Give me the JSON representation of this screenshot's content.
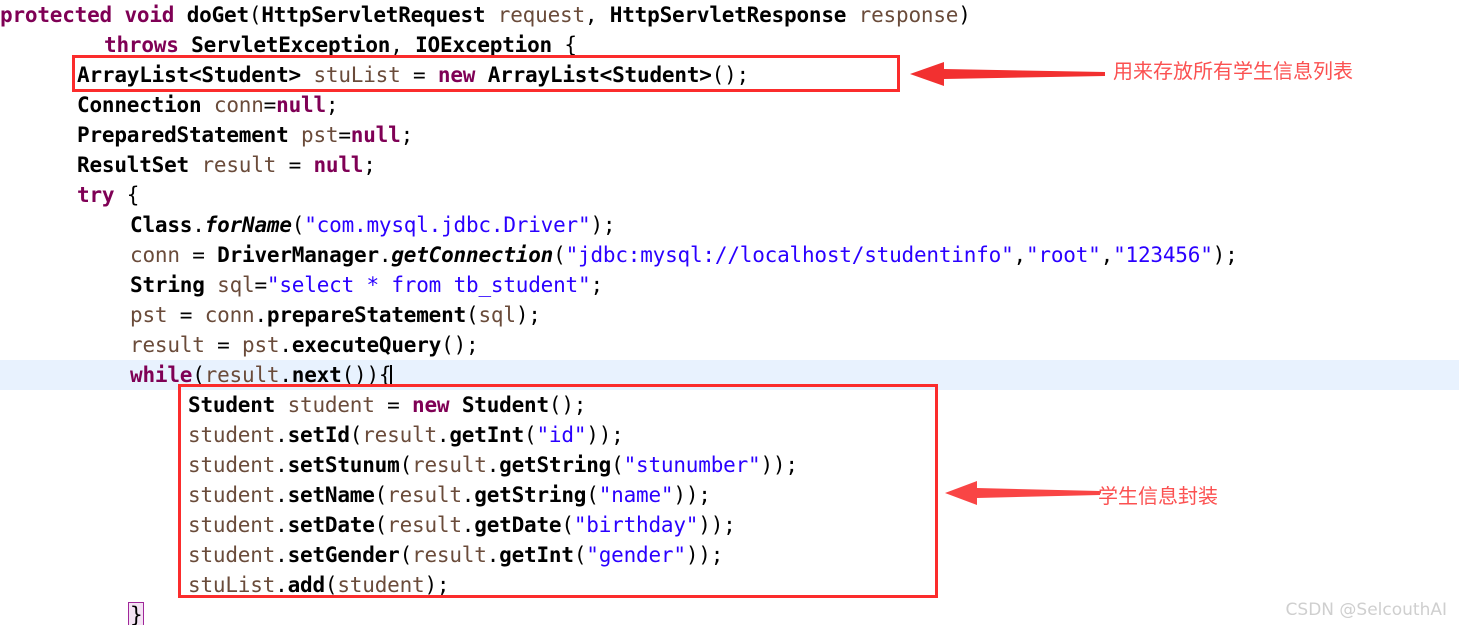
{
  "editor": {
    "language": "java",
    "current_line_index": 10,
    "caret_visible": true,
    "colors": {
      "background": "#ffffff",
      "keyword": "#7f0055",
      "string": "#2a00ff",
      "local_variable": "#6a4b3a",
      "plain_text": "#000000",
      "current_line_highlight": "#e8f2fe",
      "bracket_match_border": "#a0279a",
      "annotation_red": "#fb2c2c",
      "annotation_label_red": "#fb5151",
      "watermark": "#cfcfcf"
    },
    "lines": [
      {
        "indent": 0,
        "text": "protected void doGet(HttpServletRequest request, HttpServletResponse response)"
      },
      {
        "indent": 8,
        "text": "throws ServletException, IOException {"
      },
      {
        "indent": 4,
        "text": "ArrayList<Student> stuList = new ArrayList<Student>();"
      },
      {
        "indent": 4,
        "text": "Connection conn=null;"
      },
      {
        "indent": 4,
        "text": "PreparedStatement pst=null;"
      },
      {
        "indent": 4,
        "text": "ResultSet result = null;"
      },
      {
        "indent": 4,
        "text": "try {"
      },
      {
        "indent": 8,
        "text": "Class.forName(\"com.mysql.jdbc.Driver\");"
      },
      {
        "indent": 8,
        "text": "conn = DriverManager.getConnection(\"jdbc:mysql://localhost/studentinfo\",\"root\",\"123456\");"
      },
      {
        "indent": 8,
        "text": "String sql=\"select * from tb_student\";"
      },
      {
        "indent": 8,
        "text": "pst = conn.prepareStatement(sql);"
      },
      {
        "indent": 8,
        "text": "result = pst.executeQuery();"
      },
      {
        "indent": 8,
        "text": "while(result.next()){"
      },
      {
        "indent": 12,
        "text": "Student student = new Student();"
      },
      {
        "indent": 12,
        "text": "student.setId(result.getInt(\"id\"));"
      },
      {
        "indent": 12,
        "text": "student.setStunum(result.getString(\"stunumber\"));"
      },
      {
        "indent": 12,
        "text": "student.setName(result.getString(\"name\"));"
      },
      {
        "indent": 12,
        "text": "student.setDate(result.getDate(\"birthday\"));"
      },
      {
        "indent": 12,
        "text": "student.setGender(result.getInt(\"gender\"));"
      },
      {
        "indent": 12,
        "text": "stuList.add(student);"
      },
      {
        "indent": 8,
        "text": "}"
      }
    ]
  },
  "annotations": [
    {
      "id": "annotation-1",
      "label": "用来存放所有学生信息列表",
      "target_line": "ArrayList<Student> stuList = new ArrayList<Student>();",
      "arrow_direction": "left"
    },
    {
      "id": "annotation-2",
      "label": "学生信息封装",
      "target_line": "Student information block (setId .. stuList.add)",
      "arrow_direction": "left"
    }
  ],
  "watermark": {
    "text": "CSDN @SelcouthAI"
  }
}
